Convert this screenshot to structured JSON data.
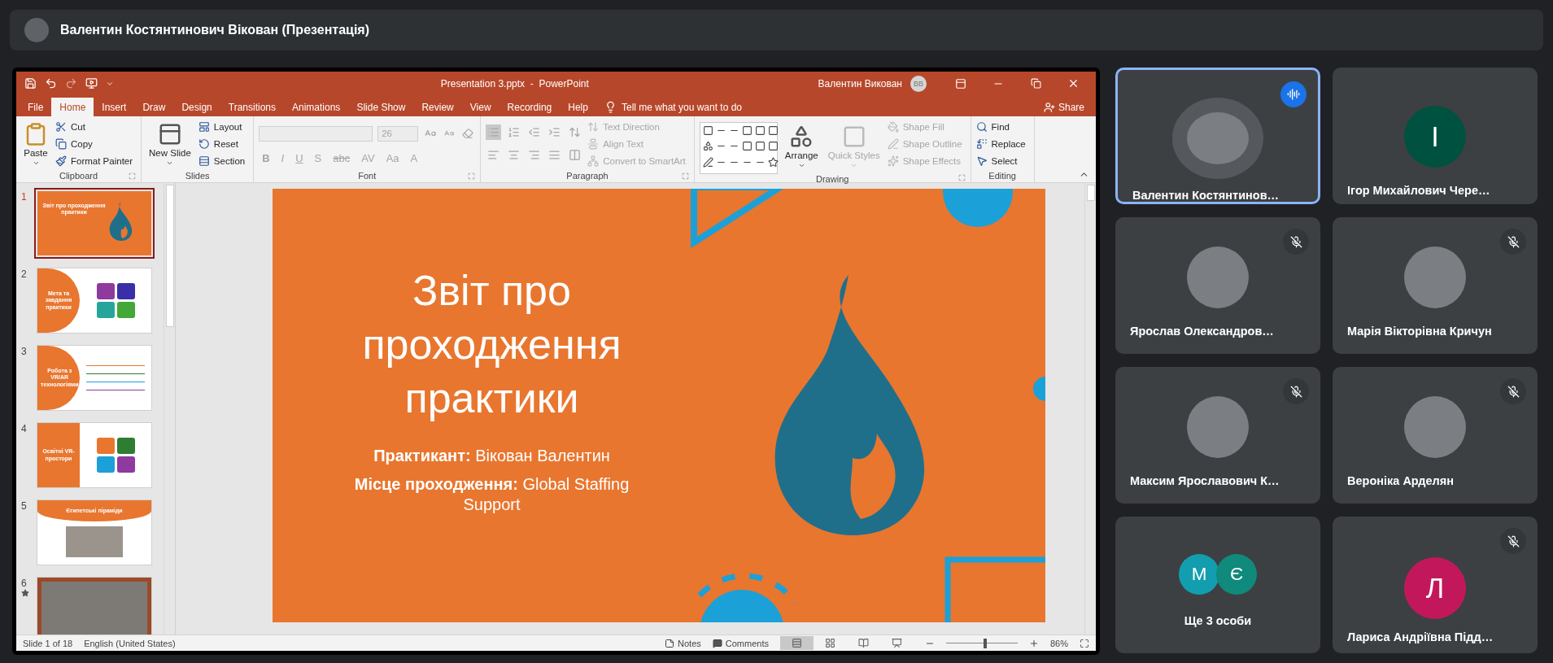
{
  "meeting_bar": {
    "title": "Валентин Костянтинович Вікован (Презентація)"
  },
  "powerpoint": {
    "doc_title": "Presentation 3.pptx  -  PowerPoint",
    "user_name": "Валентин Викован",
    "user_initials": "ВВ",
    "tabs": [
      {
        "label": "File",
        "selected": false
      },
      {
        "label": "Home",
        "selected": true
      },
      {
        "label": "Insert",
        "selected": false
      },
      {
        "label": "Draw",
        "selected": false
      },
      {
        "label": "Design",
        "selected": false
      },
      {
        "label": "Transitions",
        "selected": false
      },
      {
        "label": "Animations",
        "selected": false
      },
      {
        "label": "Slide Show",
        "selected": false
      },
      {
        "label": "Review",
        "selected": false
      },
      {
        "label": "View",
        "selected": false
      },
      {
        "label": "Recording",
        "selected": false
      },
      {
        "label": "Help",
        "selected": false
      }
    ],
    "tell_me": "Tell me what you want to do",
    "share": "Share",
    "ribbon": [
      {
        "label": "Clipboard",
        "launcher": true,
        "columns": [
          [
            {
              "kind": "large",
              "label": "Paste",
              "disabled": false
            }
          ],
          [
            {
              "kind": "small",
              "label": "Cut",
              "disabled": false
            },
            {
              "kind": "small",
              "label": "Copy",
              "disabled": false
            },
            {
              "kind": "small",
              "label": "Format Painter",
              "disabled": false
            }
          ]
        ]
      },
      {
        "label": "Slides",
        "launcher": false,
        "columns": [
          [
            {
              "kind": "large",
              "label": "New Slide",
              "disabled": false
            }
          ],
          [
            {
              "kind": "small",
              "label": "Layout",
              "disabled": false
            },
            {
              "kind": "small",
              "label": "Reset",
              "disabled": false
            },
            {
              "kind": "small",
              "label": "Section",
              "disabled": false
            }
          ]
        ]
      },
      {
        "label": "Font",
        "launcher": true,
        "columns": [
          [
            {
              "kind": "fields",
              "size": "26",
              "disabled": true
            },
            {
              "kind": "glyphs",
              "glyphs": [
                "B",
                "I",
                "U",
                "S",
                "abc",
                "AV",
                "Aa",
                "A"
              ],
              "disabled": true
            }
          ]
        ]
      },
      {
        "label": "Paragraph",
        "launcher": true,
        "columns": [
          [
            {
              "kind": "icon_row",
              "disabled": true
            },
            {
              "kind": "icon_row",
              "disabled": true
            }
          ],
          [
            {
              "kind": "small",
              "label": "Text Direction",
              "disabled": true
            },
            {
              "kind": "small",
              "label": "Align Text",
              "disabled": true
            },
            {
              "kind": "small",
              "label": "Convert to SmartArt",
              "disabled": true
            }
          ]
        ]
      },
      {
        "label": "Drawing",
        "launcher": true,
        "columns": [
          [
            {
              "kind": "gallery",
              "disabled": false
            }
          ],
          [
            {
              "kind": "large",
              "label": "Arrange",
              "disabled": false
            }
          ],
          [
            {
              "kind": "large",
              "label": "Quick Styles",
              "disabled": true
            }
          ],
          [
            {
              "kind": "small",
              "label": "Shape Fill",
              "disabled": true
            },
            {
              "kind": "small",
              "label": "Shape Outline",
              "disabled": true
            },
            {
              "kind": "small",
              "label": "Shape Effects",
              "disabled": true
            }
          ]
        ]
      },
      {
        "label": "Editing",
        "launcher": false,
        "columns": [
          [
            {
              "kind": "small",
              "label": "Find",
              "disabled": false
            },
            {
              "kind": "small",
              "label": "Replace",
              "disabled": false
            },
            {
              "kind": "small",
              "label": "Select",
              "disabled": false
            }
          ]
        ]
      }
    ],
    "thumbnails": [
      {
        "number": "1",
        "kind": "title",
        "title": "Звіт про проходження практики",
        "selected": true,
        "animated": false
      },
      {
        "number": "2",
        "kind": "circle-diagram",
        "title": "Мета та завдання практики",
        "selected": false,
        "animated": false
      },
      {
        "number": "3",
        "kind": "circle-list",
        "title": "Робота з VR/AR технологіями",
        "selected": false,
        "animated": false
      },
      {
        "number": "4",
        "kind": "split-diagram",
        "title": "Освітні VR-простори",
        "selected": false,
        "animated": false
      },
      {
        "number": "5",
        "kind": "banner-image",
        "title": "Єгипетські піраміди",
        "selected": false,
        "animated": false
      },
      {
        "number": "6",
        "kind": "image",
        "selected": false,
        "animated": true
      }
    ],
    "slide": {
      "title": "Звіт про проходження практики",
      "lines": [
        "**Практикант:** Вікован Валентин",
        "**Місце проходження:** Global Staffing Support"
      ]
    },
    "status_bar": {
      "slide_info": "Slide 1 of 18",
      "language": "English (United States)",
      "notes": "Notes",
      "comments": "Comments",
      "views": [
        {
          "selected": true
        },
        {
          "selected": false
        },
        {
          "selected": false
        },
        {
          "selected": false
        }
      ],
      "zoom": {
        "level": 0.55,
        "reading": "86%"
      }
    }
  },
  "participants": [
    {
      "name": "Валентин Костянтинов…",
      "kind": "photo",
      "speaking": true,
      "muted": false
    },
    {
      "name": "Ігор Михайлович Чере…",
      "kind": "initial",
      "avatars": [
        {
          "initial": "І",
          "color": "#00513f"
        }
      ],
      "speaking": false,
      "muted": false
    },
    {
      "name": "Ярослав Олександров…",
      "kind": "photo",
      "speaking": false,
      "muted": true
    },
    {
      "name": "Марія Вікторівна Кричун",
      "kind": "photo",
      "speaking": false,
      "muted": true
    },
    {
      "name": "Максим Ярославович К…",
      "kind": "photo",
      "speaking": false,
      "muted": true
    },
    {
      "name": "Вероніка Арделян",
      "kind": "photo",
      "speaking": false,
      "muted": true
    },
    {
      "name": "Ще 3 особи",
      "kind": "group",
      "avatars": [
        {
          "initial": "М",
          "color": "#129eaf"
        },
        {
          "initial": "Є",
          "color": "#0f8a7c"
        }
      ],
      "speaking": false,
      "muted": false
    },
    {
      "name": "Лариса Андріївна Підд…",
      "kind": "initial",
      "avatars": [
        {
          "initial": "Л",
          "color": "#c2185b"
        }
      ],
      "speaking": false,
      "muted": true
    }
  ]
}
